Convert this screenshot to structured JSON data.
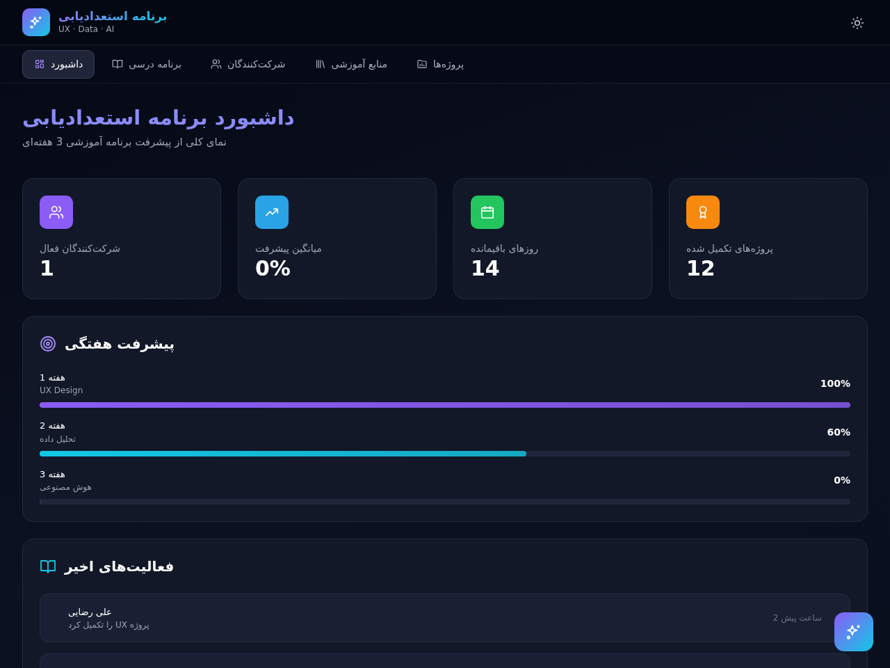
{
  "brand": {
    "title": "برنامه استعدادیابی",
    "subtitle": "UX · Data · AI"
  },
  "nav": [
    {
      "label": "پروژه‌ها",
      "selected": false
    },
    {
      "label": "منابع آموزشی",
      "selected": false
    },
    {
      "label": "شرکت‌کنندگان",
      "selected": false
    },
    {
      "label": "برنامه درسی",
      "selected": false
    },
    {
      "label": "داشبورد",
      "selected": true
    }
  ],
  "page": {
    "title": "داشبورد برنامه استعدادیابی",
    "subtitle": "نمای کلی از پیشرفت برنامه آموزشی 3 هفته‌ای"
  },
  "stats": [
    {
      "label": "پروژه‌های تکمیل شده",
      "value": "12",
      "color": "#f7890f"
    },
    {
      "label": "روزهای باقیمانده",
      "value": "14",
      "color": "#22c55e"
    },
    {
      "label": "میانگین پیشرفت",
      "value": "0%",
      "color": "#2aa3e6"
    },
    {
      "label": "شرکت‌کنندگان فعال",
      "value": "1",
      "color": "#8b5cf6"
    }
  ],
  "weekly": {
    "title": "پیشرفت هفتگی",
    "weeks": [
      {
        "week": "هفته 1",
        "subject": "UX Design",
        "percent": "100%",
        "level": 1,
        "color": "#8b5cf6"
      },
      {
        "week": "هفته 2",
        "subject": "تحلیل داده",
        "percent": "60%",
        "level": 0.6,
        "color": "#13c8e6"
      },
      {
        "week": "هفته 3",
        "subject": "هوش مصنوعی",
        "percent": "0%",
        "level": 0
      }
    ]
  },
  "activity": {
    "title": "فعالیت‌های اخیر",
    "items": [
      {
        "name": "علی رضایی",
        "text": "پروژه UX را تکمیل کرد",
        "time": "2 ساعت پیش"
      }
    ]
  }
}
